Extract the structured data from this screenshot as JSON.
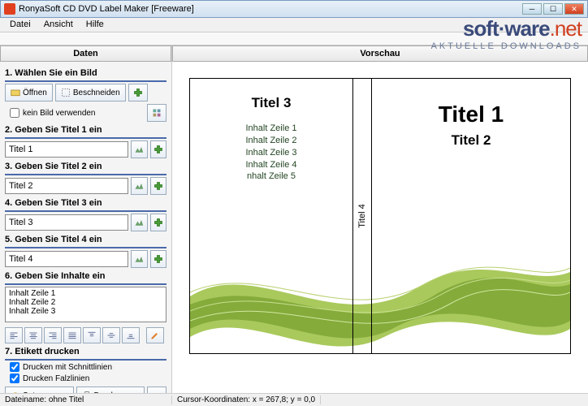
{
  "window": {
    "title": "RonyaSoft CD DVD Label Maker [Freeware]"
  },
  "menu": {
    "file": "Datei",
    "view": "Ansicht",
    "help": "Hilfe"
  },
  "watermark": {
    "logo_a": "soft",
    "logo_b": "ware",
    "logo_c": ".net",
    "sub": "AKTUELLE DOWNLOADS"
  },
  "panels": {
    "left": "Daten",
    "right": "Vorschau"
  },
  "s1": {
    "label": "1. Wählen Sie ein Bild",
    "open": "Öffnen",
    "crop": "Beschneiden",
    "noimg": "kein Bild verwenden"
  },
  "s2": {
    "label": "2. Geben Sie Titel 1 ein",
    "value": "Titel 1"
  },
  "s3": {
    "label": "3. Geben Sie Titel 2 ein",
    "value": "Titel 2"
  },
  "s4": {
    "label": "4. Geben Sie Titel 3 ein",
    "value": "Titel 3"
  },
  "s5": {
    "label": "5. Geben Sie Titel 4 ein",
    "value": "Titel 4"
  },
  "s6": {
    "label": "6. Geben Sie Inhalte ein",
    "value": "Inhalt Zeile 1\nInhalt Zeile 2\nInhalt Zeile 3"
  },
  "s7": {
    "label": "7. Etikett drucken",
    "cut": "Drucken mit Schnittlinien",
    "fold": "Drucken Falzlinien",
    "setup": "Setup",
    "print": "Drucken"
  },
  "preview": {
    "title3": "Titel 3",
    "lines": "Inhalt Zeile 1\nInhalt  Zeile 2\nInhalt  Zeile 3\nInhalt Zeile 4\nnhalt Zeile 5",
    "spine": "Titel 4",
    "title1": "Titel 1",
    "title2": "Titel 2"
  },
  "status": {
    "filename": "Dateiname: ohne Titel",
    "cursor": "Cursor-Koordinaten: x = 267,8; y =   0,0"
  }
}
